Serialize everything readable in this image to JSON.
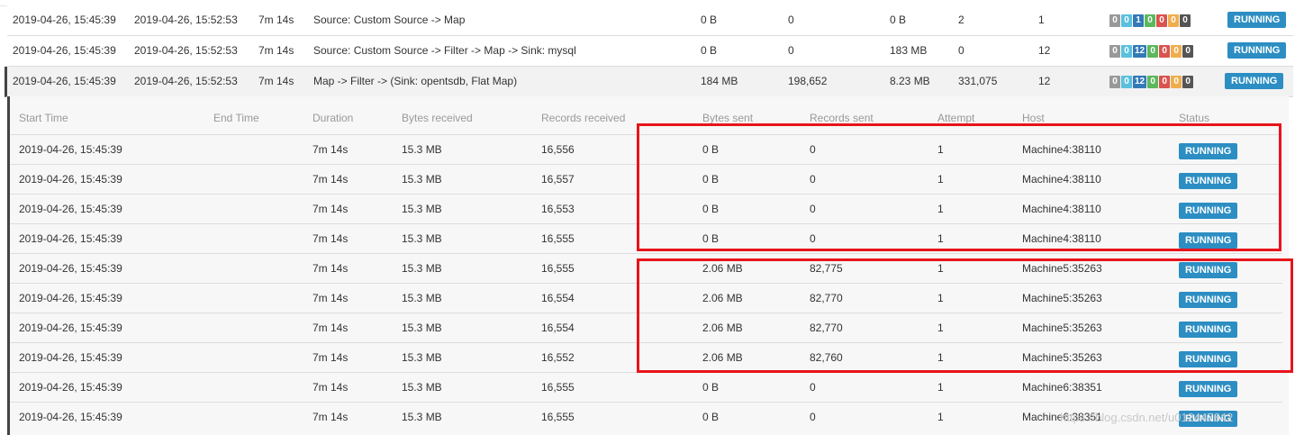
{
  "colors": {
    "badge_running": "#2c8ec3",
    "highlight_border": "#e8141b",
    "task_created": "#999999",
    "task_scheduled": "#5bc0de",
    "task_running": "#337ab7",
    "task_finished": "#5cb85c",
    "task_canceled": "#d9534f",
    "task_failed": "#f0ad4e",
    "task_other": "#555555"
  },
  "vertices": [
    {
      "start": "2019-04-26, 15:45:39",
      "end": "2019-04-26, 15:52:53",
      "duration": "7m 14s",
      "name": "Source: Custom Source -> Map",
      "bytes_received": "0 B",
      "records_received": "0",
      "bytes_sent": "0 B",
      "records_sent": "2",
      "parallelism": "1",
      "task_counts": [
        "0",
        "0",
        "1",
        "0",
        "0",
        "0",
        "0"
      ],
      "status": "RUNNING"
    },
    {
      "start": "2019-04-26, 15:45:39",
      "end": "2019-04-26, 15:52:53",
      "duration": "7m 14s",
      "name": "Source: Custom Source -> Filter -> Map -> Sink: mysql",
      "bytes_received": "0 B",
      "records_received": "0",
      "bytes_sent": "183 MB",
      "records_sent": "0",
      "parallelism": "12",
      "task_counts": [
        "0",
        "0",
        "12",
        "0",
        "0",
        "0",
        "0"
      ],
      "status": "RUNNING"
    },
    {
      "start": "2019-04-26, 15:45:39",
      "end": "2019-04-26, 15:52:53",
      "duration": "7m 14s",
      "name": "Map -> Filter -> (Sink: opentsdb, Flat Map)",
      "bytes_received": "184 MB",
      "records_received": "198,652",
      "bytes_sent": "8.23 MB",
      "records_sent": "331,075",
      "parallelism": "12",
      "task_counts": [
        "0",
        "0",
        "12",
        "0",
        "0",
        "0",
        "0"
      ],
      "status": "RUNNING"
    }
  ],
  "subtasks_header": {
    "start_time": "Start Time",
    "end_time": "End Time",
    "duration": "Duration",
    "bytes_received": "Bytes received",
    "records_received": "Records received",
    "bytes_sent": "Bytes sent",
    "records_sent": "Records sent",
    "attempt": "Attempt",
    "host": "Host",
    "status": "Status"
  },
  "subtasks": [
    {
      "start": "2019-04-26, 15:45:39",
      "end": "",
      "duration": "7m 14s",
      "bytes_received": "15.3 MB",
      "records_received": "16,556",
      "bytes_sent": "0 B",
      "records_sent": "0",
      "attempt": "1",
      "host": "Machine4:38110",
      "status": "RUNNING"
    },
    {
      "start": "2019-04-26, 15:45:39",
      "end": "",
      "duration": "7m 14s",
      "bytes_received": "15.3 MB",
      "records_received": "16,557",
      "bytes_sent": "0 B",
      "records_sent": "0",
      "attempt": "1",
      "host": "Machine4:38110",
      "status": "RUNNING"
    },
    {
      "start": "2019-04-26, 15:45:39",
      "end": "",
      "duration": "7m 14s",
      "bytes_received": "15.3 MB",
      "records_received": "16,553",
      "bytes_sent": "0 B",
      "records_sent": "0",
      "attempt": "1",
      "host": "Machine4:38110",
      "status": "RUNNING"
    },
    {
      "start": "2019-04-26, 15:45:39",
      "end": "",
      "duration": "7m 14s",
      "bytes_received": "15.3 MB",
      "records_received": "16,555",
      "bytes_sent": "0 B",
      "records_sent": "0",
      "attempt": "1",
      "host": "Machine4:38110",
      "status": "RUNNING"
    },
    {
      "start": "2019-04-26, 15:45:39",
      "end": "",
      "duration": "7m 14s",
      "bytes_received": "15.3 MB",
      "records_received": "16,555",
      "bytes_sent": "2.06 MB",
      "records_sent": "82,775",
      "attempt": "1",
      "host": "Machine5:35263",
      "status": "RUNNING"
    },
    {
      "start": "2019-04-26, 15:45:39",
      "end": "",
      "duration": "7m 14s",
      "bytes_received": "15.3 MB",
      "records_received": "16,554",
      "bytes_sent": "2.06 MB",
      "records_sent": "82,770",
      "attempt": "1",
      "host": "Machine5:35263",
      "status": "RUNNING"
    },
    {
      "start": "2019-04-26, 15:45:39",
      "end": "",
      "duration": "7m 14s",
      "bytes_received": "15.3 MB",
      "records_received": "16,554",
      "bytes_sent": "2.06 MB",
      "records_sent": "82,770",
      "attempt": "1",
      "host": "Machine5:35263",
      "status": "RUNNING"
    },
    {
      "start": "2019-04-26, 15:45:39",
      "end": "",
      "duration": "7m 14s",
      "bytes_received": "15.3 MB",
      "records_received": "16,552",
      "bytes_sent": "2.06 MB",
      "records_sent": "82,760",
      "attempt": "1",
      "host": "Machine5:35263",
      "status": "RUNNING"
    },
    {
      "start": "2019-04-26, 15:45:39",
      "end": "",
      "duration": "7m 14s",
      "bytes_received": "15.3 MB",
      "records_received": "16,555",
      "bytes_sent": "0 B",
      "records_sent": "0",
      "attempt": "1",
      "host": "Machine6:38351",
      "status": "RUNNING"
    },
    {
      "start": "2019-04-26, 15:45:39",
      "end": "",
      "duration": "7m 14s",
      "bytes_received": "15.3 MB",
      "records_received": "16,555",
      "bytes_sent": "0 B",
      "records_sent": "0",
      "attempt": "1",
      "host": "Machine6:38351",
      "status": "RUNNING"
    }
  ],
  "watermark": "https://blog.csdn.net/u012447842"
}
